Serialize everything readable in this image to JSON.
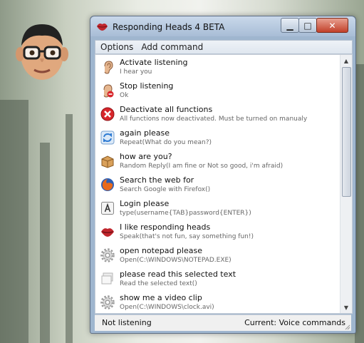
{
  "window": {
    "title": "Responding Heads 4 BETA"
  },
  "menu": {
    "options": "Options",
    "add_command": "Add command"
  },
  "commands": [
    {
      "title": "Activate listening",
      "detail": "I hear you",
      "icon": "ear-icon"
    },
    {
      "title": "Stop listening",
      "detail": "Ok",
      "icon": "ear-stop-icon"
    },
    {
      "title": "Deactivate all functions",
      "detail": "All functions now deactivated. Must be turned on manualy",
      "icon": "red-x-icon"
    },
    {
      "title": "again please",
      "detail": "Repeat(What do you mean?)",
      "icon": "repeat-icon"
    },
    {
      "title": "how are you?",
      "detail": "Random Reply(I am fine or Not so good, i'm afraid)",
      "icon": "box-icon"
    },
    {
      "title": "Search the web for",
      "detail": "Search Google with Firefox()",
      "icon": "firefox-icon"
    },
    {
      "title": "Login please",
      "detail": "type(username{TAB}password{ENTER})",
      "icon": "keyboard-a-icon"
    },
    {
      "title": "I like responding heads",
      "detail": "Speak(that's not fun, say something fun!)",
      "icon": "lips-icon"
    },
    {
      "title": "open notepad please",
      "detail": "Open(C:\\WINDOWS\\NOTEPAD.EXE)",
      "icon": "gear-icon"
    },
    {
      "title": "please read this selected text",
      "detail": "Read the selected text()",
      "icon": "windows-icon"
    },
    {
      "title": "show me a video clip",
      "detail": "Open(C:\\WINDOWS\\clock.avi)",
      "icon": "gear-icon"
    }
  ],
  "status": {
    "left": "Not listening",
    "right": "Current: Voice commands"
  }
}
